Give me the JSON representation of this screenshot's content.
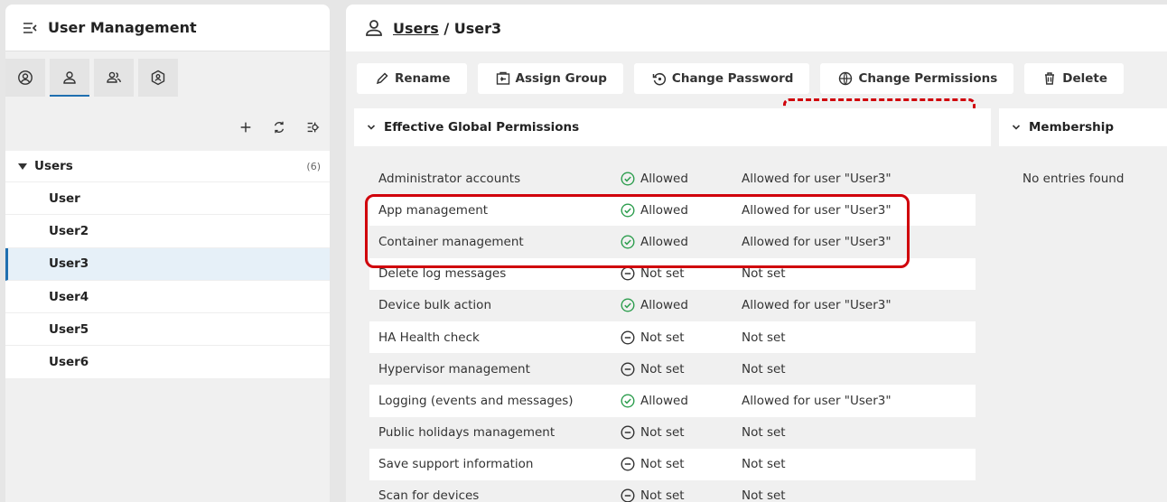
{
  "left": {
    "title": "User Management",
    "tabs": [
      "account-icon",
      "user-icon",
      "group-icon",
      "role-icon"
    ],
    "tree": {
      "group_label": "Users",
      "group_count": "(6)",
      "items": [
        "User",
        "User2",
        "User3",
        "User4",
        "User5",
        "User6"
      ],
      "selected": "User3"
    }
  },
  "right": {
    "breadcrumb": {
      "link": "Users",
      "separator": " / ",
      "current": "User3"
    },
    "buttons": {
      "rename": "Rename",
      "assign_group": "Assign Group",
      "change_password": "Change Password",
      "change_permissions": "Change Permissions",
      "delete": "Delete"
    },
    "permissions": {
      "title": "Effective Global Permissions",
      "rows": [
        {
          "name": "Administrator accounts",
          "status": "Allowed",
          "reason": "Allowed for user \"User3\""
        },
        {
          "name": "App management",
          "status": "Allowed",
          "reason": "Allowed for user \"User3\""
        },
        {
          "name": "Container management",
          "status": "Allowed",
          "reason": "Allowed for user \"User3\""
        },
        {
          "name": "Delete log messages",
          "status": "Not set",
          "reason": "Not set"
        },
        {
          "name": "Device bulk action",
          "status": "Allowed",
          "reason": "Allowed for user \"User3\""
        },
        {
          "name": "HA Health check",
          "status": "Not set",
          "reason": "Not set"
        },
        {
          "name": "Hypervisor management",
          "status": "Not set",
          "reason": "Not set"
        },
        {
          "name": "Logging (events and messages)",
          "status": "Allowed",
          "reason": "Allowed for user \"User3\""
        },
        {
          "name": "Public holidays management",
          "status": "Not set",
          "reason": "Not set"
        },
        {
          "name": "Save support information",
          "status": "Not set",
          "reason": "Not set"
        },
        {
          "name": "Scan for devices",
          "status": "Not set",
          "reason": "Not set"
        }
      ]
    },
    "membership": {
      "title": "Membership",
      "empty": "No entries found"
    }
  },
  "colors": {
    "accent": "#1f6fb0",
    "allowed": "#2e9e4f",
    "annotation": "#d0000b"
  }
}
